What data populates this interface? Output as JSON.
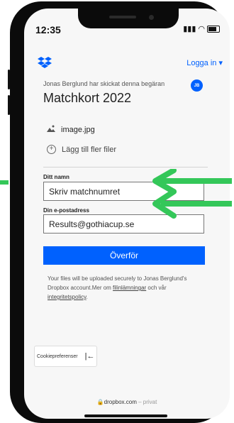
{
  "status_bar": {
    "time": "12:35"
  },
  "header": {
    "login_label": "Logga in ▾"
  },
  "request": {
    "sender_text": "Jonas Berglund har skickat denna begäran",
    "avatar_initials": "JB",
    "title": "Matchkort 2022"
  },
  "files": {
    "uploaded_name": "image.jpg",
    "add_more_label": "Lägg till fler filer"
  },
  "form": {
    "name_label": "Ditt namn",
    "name_value": "Skriv matchnumret",
    "email_label": "Din e-postadress",
    "email_value": "Results@gothiacup.se",
    "submit_label": "Överför"
  },
  "notice": {
    "text": "Your files will be uploaded securely to Jonas Berglund's Dropbox account.Mer om ",
    "link1": "filinlämningar",
    "mid": " och vår ",
    "link2": "integritetspolicy",
    "end": "."
  },
  "cookie": {
    "label": "Cookiepreferenser",
    "collapse_icon": "collapse-left-icon"
  },
  "footer": {
    "domain": "dropbox.com",
    "suffix": " – privat"
  },
  "colors": {
    "accent": "#0061fe",
    "arrow": "#34c759",
    "phone": "#0b0b0b"
  }
}
